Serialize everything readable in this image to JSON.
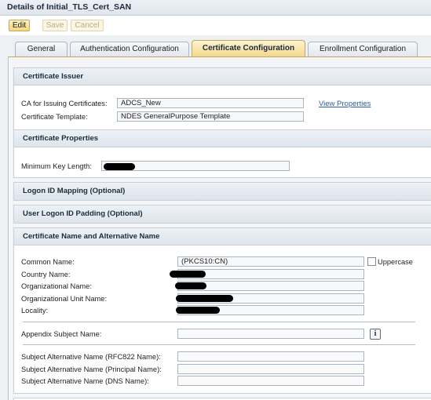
{
  "window": {
    "title": "Details of Initial_TLS_Cert_SAN"
  },
  "toolbar": {
    "edit_label": "Edit",
    "save_label": "Save",
    "cancel_label": "Cancel"
  },
  "tabs": [
    {
      "label": "General",
      "active": false
    },
    {
      "label": "Authentication Configuration",
      "active": false
    },
    {
      "label": "Certificate Configuration",
      "active": true
    },
    {
      "label": "Enrollment Configuration",
      "active": false
    }
  ],
  "issuer": {
    "title": "Certificate Issuer",
    "ca_label": "CA for Issuing Certificates:",
    "ca_value": "ADCS_New",
    "view_properties": "View Properties",
    "template_label": "Certificate Template:",
    "template_value": "NDES GeneralPurpose Template"
  },
  "properties": {
    "title": "Certificate Properties",
    "min_key_label": "Minimum Key Length:",
    "min_key_value": ""
  },
  "logon_mapping": {
    "title": "Logon ID Mapping (Optional)"
  },
  "user_logon_padding": {
    "title": "User Logon ID Padding (Optional)"
  },
  "cert_name": {
    "title": "Certificate Name and Alternative Name",
    "common_name_label": "Common Name:",
    "common_name_value": "(PKCS10:CN)",
    "uppercase_label": "Uppercase",
    "country_label": "Country Name:",
    "org_label": "Organizational Name:",
    "org_unit_label": "Organizational Unit Name:",
    "locality_label": "Locality:",
    "appendix_label": "Appendix Subject Name:",
    "san_rfc822_label": "Subject Alternative Name (RFC822 Name):",
    "san_principal_label": "Subject Alternative Name (Principal Name):",
    "san_dns_label": "Subject Alternative Name (DNS Name):"
  }
}
